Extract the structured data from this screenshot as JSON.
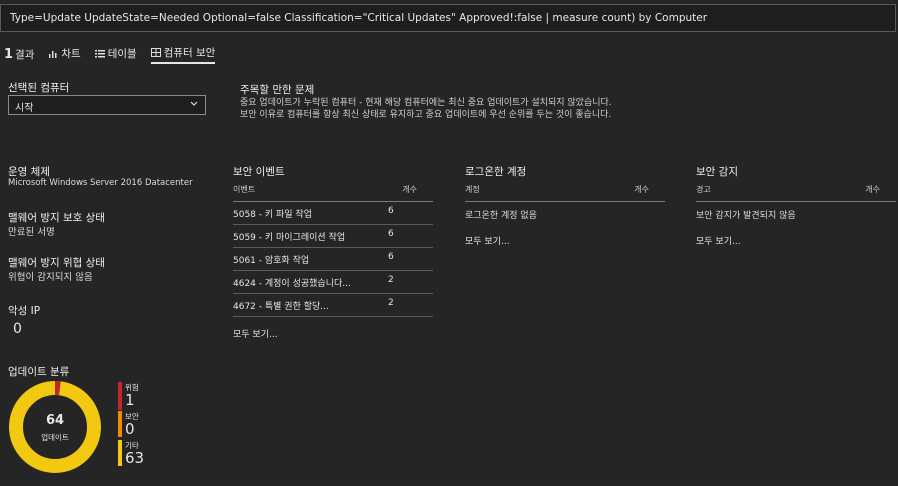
{
  "query": "Type=Update UpdateState=Needed Optional=false Classification=\"Critical Updates\" Approved!:false | measure count) by Computer",
  "tabs": {
    "result_count": "1",
    "result_label": "결과",
    "chart": "차트",
    "table": "테이블",
    "security": "컴퓨터 보안"
  },
  "selected_computer": {
    "label": "선택된 컴퓨터",
    "value": "시작"
  },
  "notice": {
    "title": "주목할 만한 문제",
    "line1": "중요 업데이트가 누락된 컴퓨터 - 현재 해당 컴퓨터에는 최신 중요 업데이트가 설치되지 않았습니다.",
    "line2": "보안 이유로 컴퓨터를 항상 최신 상태로 유지하고 중요 업데이트에 우선 순위를 두는 것이 좋습니다."
  },
  "left": {
    "os_label": "운영 체제",
    "os_value": "Microsoft Windows Server 2016 Datacenter",
    "malware_label": "맬웨어 방지 보호 상태",
    "malware_value": "만료된 서명",
    "threat_label": "맬웨어 방지 위협 상태",
    "threat_value": "위협이 감지되지 않음",
    "malicious_ip_label": "악성 IP",
    "malicious_ip_value": "0",
    "updates_label": "업데이트 분류"
  },
  "security_events": {
    "title": "보안 이벤트",
    "col_event": "이벤트",
    "col_count": "개수",
    "rows": [
      {
        "name": "5058 - 키 파일 작업",
        "count": "6"
      },
      {
        "name": "5059 - 키 마이그레이션 작업",
        "count": "6"
      },
      {
        "name": "5061 - 암호화 작업",
        "count": "6"
      },
      {
        "name": "4624 - 계정이 성공했습니다...",
        "count": "2"
      },
      {
        "name": "4672 - 특별 권한 할당...",
        "count": "2"
      }
    ],
    "see_all": "모두 보기..."
  },
  "logged_accounts": {
    "title": "로그온한 계정",
    "col_account": "계정",
    "col_count": "개수",
    "empty": "로그온한 계정 없음",
    "see_all": "모두 보기..."
  },
  "security_detection": {
    "title": "보안 감지",
    "col_alert": "경고",
    "col_count": "개수",
    "empty": "보안 감지가 발견되지 않음",
    "see_all": "모두 보기..."
  },
  "donut": {
    "total": "64",
    "total_label": "업데이트",
    "segments": [
      {
        "label": "위험",
        "value": "1",
        "color": "#c0282d"
      },
      {
        "label": "보안",
        "value": "0",
        "color": "#f28a00"
      },
      {
        "label": "기타",
        "value": "63",
        "color": "#f2c811"
      }
    ]
  }
}
